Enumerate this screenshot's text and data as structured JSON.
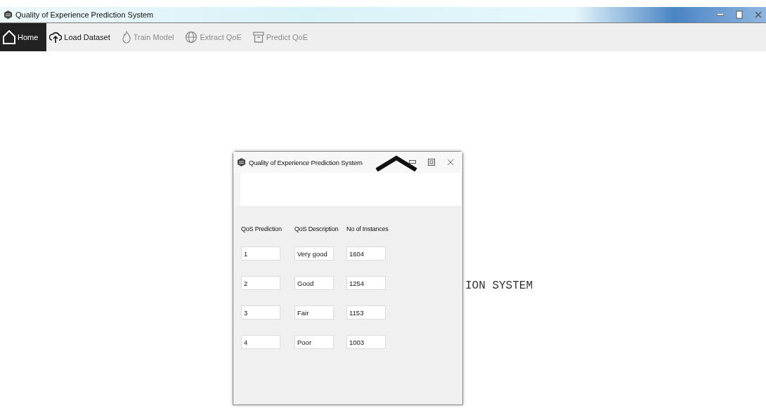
{
  "window": {
    "title": "Quality of Experience Prediction System"
  },
  "toolbar": [
    {
      "label": "Home",
      "selected": true,
      "disabled": false
    },
    {
      "label": "Load Dataset",
      "selected": false,
      "disabled": false
    },
    {
      "label": "Train Model",
      "selected": false,
      "disabled": true
    },
    {
      "label": "Extract QoE",
      "selected": false,
      "disabled": true
    },
    {
      "label": "Predict QoE",
      "selected": false,
      "disabled": true
    }
  ],
  "background_text": "ION SYSTEM",
  "dialog": {
    "title": "Quality of Experience Prediction System",
    "columns": [
      "QoS Prediction",
      "QoS Description",
      "No of Instances"
    ],
    "rows": [
      [
        "1",
        "Very good",
        "1604"
      ],
      [
        "2",
        "Good",
        "1254"
      ],
      [
        "3",
        "Fair",
        "1153"
      ],
      [
        "4",
        "Poor",
        "1003"
      ]
    ]
  }
}
